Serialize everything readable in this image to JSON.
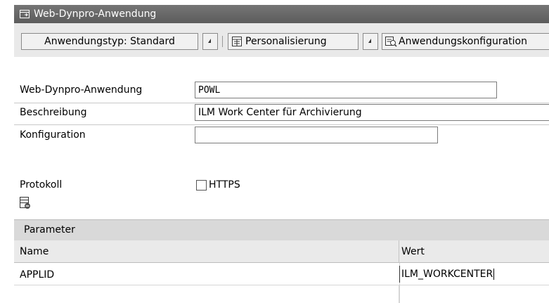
{
  "window": {
    "title": "Web-Dynpro-Anwendung",
    "icon": "window-icon"
  },
  "toolbar": {
    "app_type_label": "Anwendungstyp: Standard",
    "personalization_label": "Personalisierung",
    "personalization_icon": "personalization-icon",
    "app_config_label": "Anwendungskonfiguration",
    "app_config_icon": "configuration-icon"
  },
  "form": {
    "app_label": "Web-Dynpro-Anwendung",
    "app_value": "POWL",
    "desc_label": "Beschreibung",
    "desc_value": "ILM Work Center für Archivierung",
    "config_label": "Konfiguration",
    "config_value": "",
    "protocol_label": "Protokoll",
    "https_label": "HTTPS",
    "https_checked": false
  },
  "params": {
    "section_label": "Parameter",
    "columns": [
      "Name",
      "Wert"
    ],
    "rows": [
      {
        "name": "APPLID",
        "value": "ILM_WORKCENTER"
      }
    ]
  }
}
